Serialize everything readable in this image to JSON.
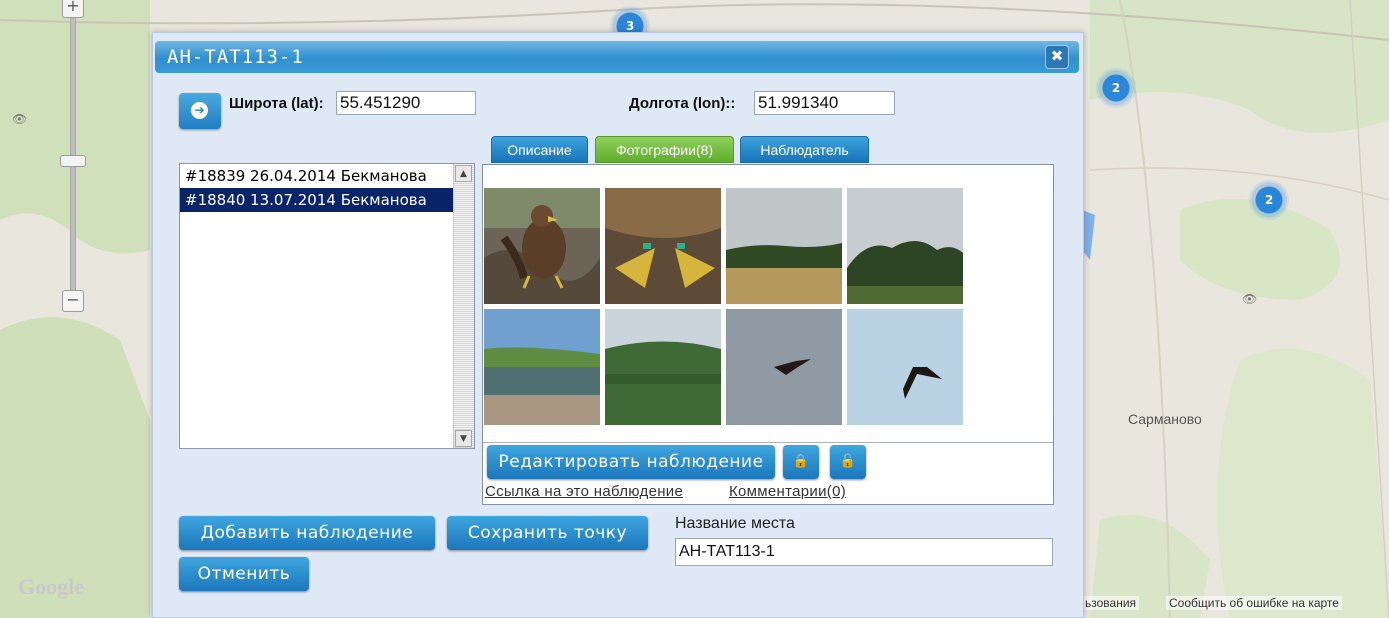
{
  "map": {
    "clusters": [
      {
        "count": "3"
      },
      {
        "count": "2"
      },
      {
        "count": "2"
      }
    ],
    "town_label": "Сарманово",
    "attribution_logo": "Google",
    "footer_partial": "ьзования",
    "footer_report": "Сообщить об ошибке на карте",
    "zoom_in_icon": "+",
    "zoom_out_icon": "−",
    "eye_icon": "👁"
  },
  "dialog": {
    "title": "АН-ТАТ113-1",
    "close_icon": "✖",
    "go_icon": "➔",
    "lat_label": "Широта (lat):",
    "lat_value": "55.451290",
    "lon_label": "Долгота (lon)::",
    "lon_value": "51.991340",
    "observations": [
      "#18839 26.04.2014 Бекманова",
      "#18840 13.07.2014 Бекманова"
    ],
    "selected_observation": 1,
    "tabs": [
      {
        "label": "Описание"
      },
      {
        "label": "Фотографии(8)"
      },
      {
        "label": "Наблюдатель"
      }
    ],
    "active_tab": 1,
    "photos": [
      {
        "icon": "eagle-chick-photo"
      },
      {
        "icon": "eagle-talons-photo"
      },
      {
        "icon": "field-forest-photo"
      },
      {
        "icon": "forest-edge-photo"
      },
      {
        "icon": "lake-road-photo"
      },
      {
        "icon": "pine-forest-photo"
      },
      {
        "icon": "eagle-flying-photo"
      },
      {
        "icon": "eagle-sky-photo"
      }
    ],
    "edit_button": "Редактировать наблюдение",
    "lock_icon": "🔒",
    "unlock_icon": "🔓",
    "link_text": "Ссылка на это наблюдение",
    "comments_text": "Комментарии(0)",
    "add_button": "Добавить наблюдение",
    "save_button": "Сохранить точку",
    "cancel_button": "Отменить",
    "place_label": "Название места",
    "place_value": "АН-ТАТ113-1"
  },
  "colors": {
    "accent": "#1f7fc2",
    "active_tab": "#6bb83a",
    "selection": "#0a246a"
  }
}
